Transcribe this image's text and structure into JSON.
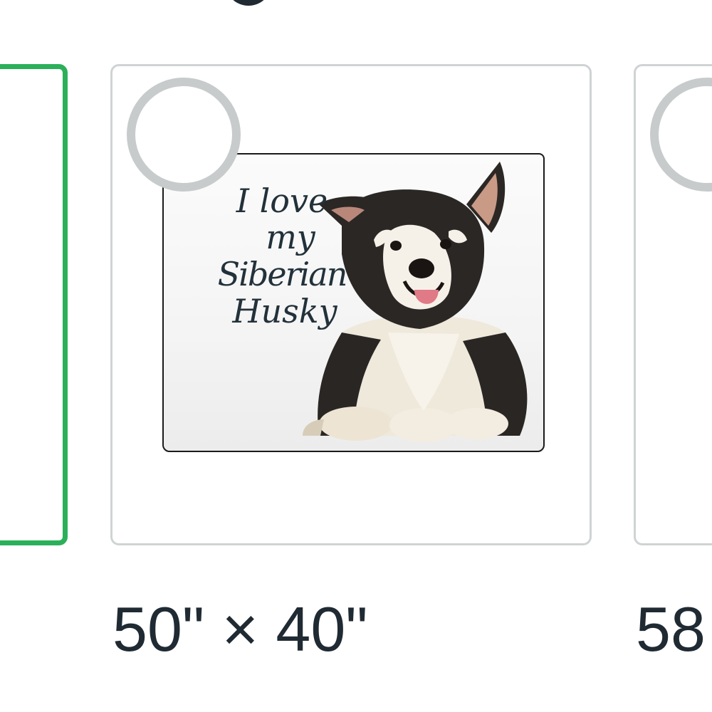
{
  "heading": {
    "visible_fragment": "g"
  },
  "options": [
    {
      "id": "left",
      "selected": true,
      "size_label": ""
    },
    {
      "id": "center",
      "selected": false,
      "size_label": "50\" × 40\"",
      "product_text": {
        "line1": "I love",
        "line2": "my",
        "line3": "Siberian",
        "line4": "Husky"
      }
    },
    {
      "id": "right",
      "selected": false,
      "size_label": "58"
    }
  ],
  "colors": {
    "selected_border": "#2bb05a",
    "card_border": "#cfd3d4",
    "radio_ring": "#c7cbcc",
    "text": "#1f2a33"
  },
  "icons": {
    "radio_unselected": "radio-empty-icon"
  }
}
